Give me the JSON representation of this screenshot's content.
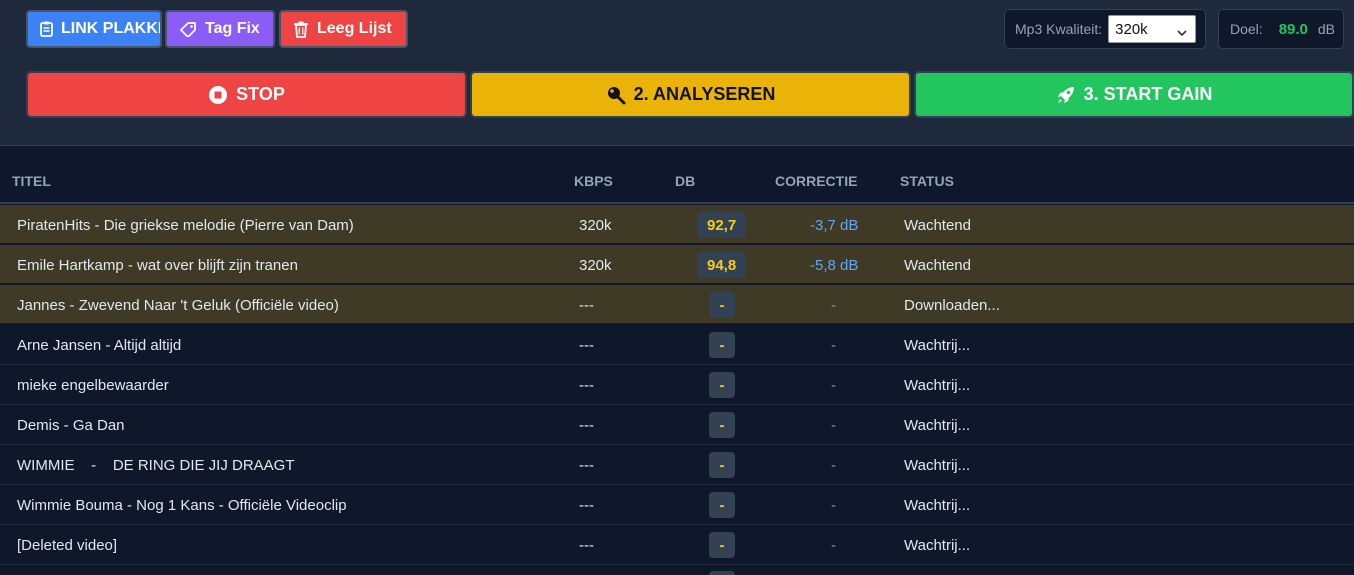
{
  "toolbar": {
    "link_label": "LINK PLAKKEN",
    "tag_label": "Tag Fix",
    "clear_label": "Leeg Lijst",
    "quality_label": "Mp3 Kwaliteit:",
    "quality_value": "320k",
    "target_label": "Doel:",
    "target_value": "89.0",
    "target_unit": "dB"
  },
  "actions": {
    "stop": "STOP",
    "analyze": "2. ANALYSEREN",
    "start": "3. START GAIN"
  },
  "table": {
    "headers": {
      "title": "TITEL",
      "kbps": "KBPS",
      "db": "DB",
      "correction": "CORRECTIE",
      "status": "STATUS"
    },
    "rows": [
      {
        "title": "PiratenHits - Die griekse melodie (Pierre van Dam)",
        "kbps": "320k",
        "db": "92,7",
        "correction": "-3,7 dB",
        "status": "Wachtend"
      },
      {
        "title": "Emile Hartkamp - wat over blijft zijn tranen",
        "kbps": "320k",
        "db": "94,8",
        "correction": "-5,8 dB",
        "status": "Wachtend"
      },
      {
        "title": "Jannes - Zwevend Naar 't Geluk (Officiële video)",
        "kbps": "---",
        "db": "-",
        "correction": "-",
        "status": "Downloaden..."
      },
      {
        "title": "Arne Jansen - Altijd altijd",
        "kbps": "---",
        "db": "-",
        "correction": "-",
        "status": "Wachtrij..."
      },
      {
        "title": "mieke engelbewaarder",
        "kbps": "---",
        "db": "-",
        "correction": "-",
        "status": "Wachtrij..."
      },
      {
        "title": "Demis - Ga Dan",
        "kbps": "---",
        "db": "-",
        "correction": "-",
        "status": "Wachtrij..."
      },
      {
        "title": "WIMMIE    -    DE RING DIE JIJ DRAAGT",
        "kbps": "---",
        "db": "-",
        "correction": "-",
        "status": "Wachtrij..."
      },
      {
        "title": "Wimmie Bouma - Nog 1 Kans - Officiële Videoclip",
        "kbps": "---",
        "db": "-",
        "correction": "-",
        "status": "Wachtrij..."
      },
      {
        "title": "[Deleted video]",
        "kbps": "---",
        "db": "-",
        "correction": "-",
        "status": "Wachtrij..."
      }
    ]
  }
}
